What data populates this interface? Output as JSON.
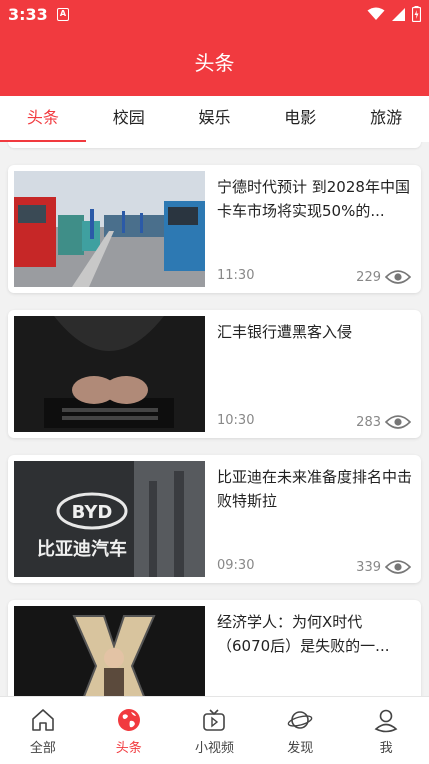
{
  "status": {
    "time": "3:33",
    "notif": "A"
  },
  "app": {
    "title": "头条"
  },
  "tabs": [
    {
      "label": "头条",
      "active": true
    },
    {
      "label": "校园",
      "active": false
    },
    {
      "label": "娱乐",
      "active": false
    },
    {
      "label": "电影",
      "active": false
    },
    {
      "label": "旅游",
      "active": false
    }
  ],
  "feed": [
    {
      "title": "宁德时代预计 到2028年中国卡车市场将实现50%的...",
      "time": "11:30",
      "views": "229",
      "image": "trucks-photo"
    },
    {
      "title": "汇丰银行遭黑客入侵",
      "time": "10:30",
      "views": "283",
      "image": "hacker-photo"
    },
    {
      "title": "比亚迪在未来准备度排名中击败特斯拉",
      "time": "09:30",
      "views": "339",
      "image": "byd-logo-photo"
    },
    {
      "title": "经济学人：为何X时代（6070后）是失败的一...",
      "time": "",
      "views": "",
      "image": "x-cartoon-illustration"
    }
  ],
  "byd_logo_text": "BYD",
  "byd_brand_text": "比亚迪汽车",
  "nav": [
    {
      "label": "全部",
      "icon": "home-icon",
      "active": false
    },
    {
      "label": "头条",
      "icon": "globe-icon",
      "active": true
    },
    {
      "label": "小视频",
      "icon": "tv-icon",
      "active": false
    },
    {
      "label": "发现",
      "icon": "planet-icon",
      "active": false
    },
    {
      "label": "我",
      "icon": "user-icon",
      "active": false
    }
  ],
  "colors": {
    "accent": "#f13a3f",
    "text": "#222222",
    "muted": "#888888"
  }
}
